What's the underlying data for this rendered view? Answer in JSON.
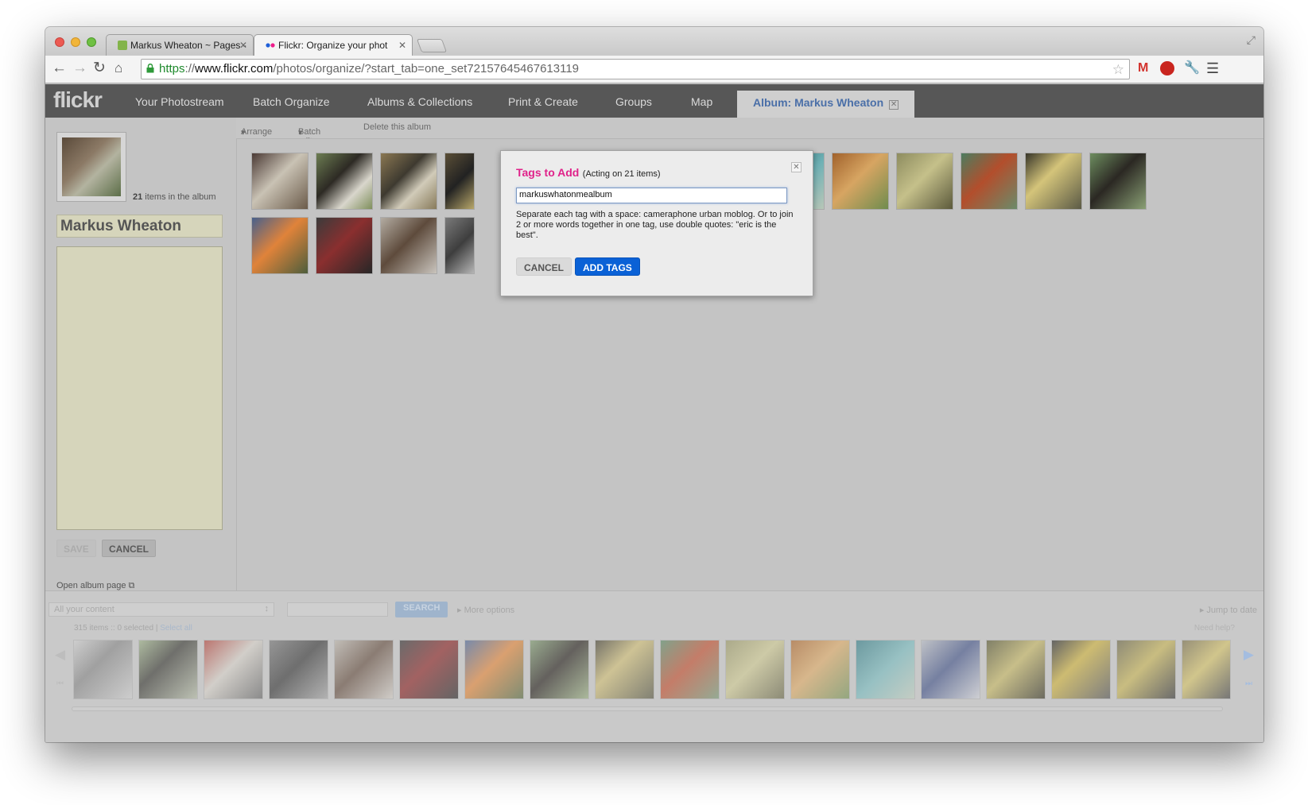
{
  "browser": {
    "tabs": [
      {
        "label": "Markus Wheaton ~ Pages -",
        "active": false
      },
      {
        "label": "Flickr: Organize your phot",
        "active": true
      }
    ],
    "url": {
      "scheme": "https",
      "separator": "://",
      "host": "www.flickr.com",
      "path": "/photos/organize/?start_tab=one_set72157645467613119"
    }
  },
  "flickr": {
    "logo": "flickr",
    "nav": [
      "Your Photostream",
      "Batch Organize",
      "Albums & Collections",
      "Print & Create",
      "Groups",
      "Map"
    ],
    "active_tab": "Album: Markus Wheaton",
    "subnav": {
      "arrange": "Arrange",
      "batch_edit": "Batch edit",
      "delete": "Delete this album"
    }
  },
  "album": {
    "count": "21",
    "count_suffix": " items in the album",
    "title": "Markus Wheaton",
    "save_label": "SAVE",
    "cancel_label": "CANCEL",
    "open_album": "Open album page"
  },
  "bottom": {
    "filter": "All your content",
    "search_label": "SEARCH",
    "more_options": "More options",
    "jump_to_date": "Jump to date",
    "count": "315 items :: 0 selected | ",
    "select_all": "Select all",
    "need_help": "Need help?"
  },
  "dialog": {
    "title": "Tags to Add",
    "subtitle": "(Acting on 21 items)",
    "input_value": "markuswhatonmealbum",
    "help": "Separate each tag with a space: cameraphone urban moblog. Or to join 2 or more words together in one tag, use double quotes: \"eric is the best\".",
    "cancel_label": "CANCEL",
    "add_label": "ADD TAGS"
  },
  "colors": {
    "dialog_title": "#e0228a",
    "add_button": "#0a61d6",
    "active_tab_text": "#4a6fa8",
    "nav_bar": "#575757"
  },
  "icons": [
    "back-icon",
    "forward-icon",
    "reload-icon",
    "home-icon",
    "lock-icon",
    "star-icon",
    "gmail-icon",
    "adblock-icon",
    "wrench-icon",
    "menu-icon",
    "close-icon"
  ]
}
